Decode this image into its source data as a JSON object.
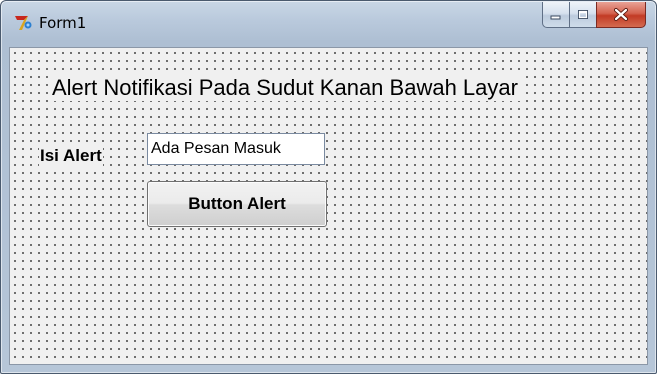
{
  "window": {
    "title": "Form1",
    "app_icon": "delphi-app-icon",
    "caption_buttons": [
      "minimize-icon",
      "maximize-icon",
      "close-icon"
    ]
  },
  "form": {
    "heading": "Alert Notifikasi Pada Sudut Kanan Bawah Layar",
    "isi_label": "Isi Alert",
    "input_value": "Ada Pesan Masuk",
    "button_label": "Button Alert"
  },
  "colors": {
    "close_button": "#c9432c",
    "client_background": "#f0f0f0",
    "grid_dots": "#5a5a5a"
  }
}
